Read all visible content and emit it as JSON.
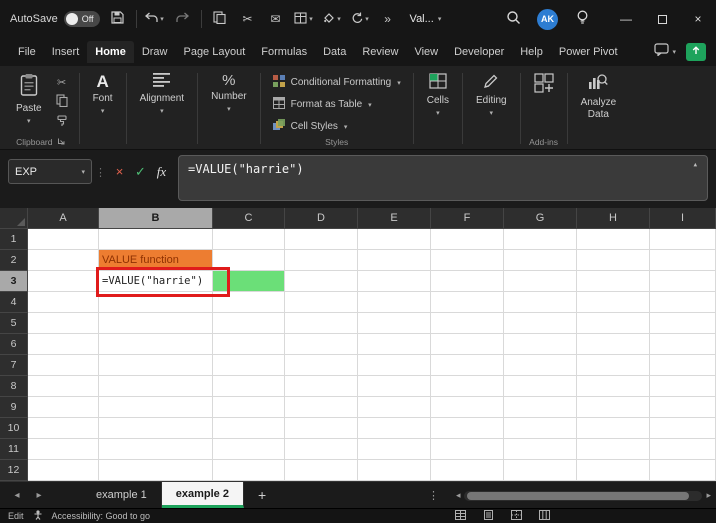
{
  "titlebar": {
    "autosave_label": "AutoSave",
    "autosave_state": "Off",
    "doc_name": "Val...",
    "avatar_initials": "AK",
    "overflow": "»"
  },
  "menubar": {
    "items": [
      "File",
      "Insert",
      "Home",
      "Draw",
      "Page Layout",
      "Formulas",
      "Data",
      "Review",
      "View",
      "Developer",
      "Help",
      "Power Pivot"
    ],
    "active": "Home"
  },
  "ribbon": {
    "paste_label": "Paste",
    "font_label": "Font",
    "alignment_label": "Alignment",
    "number_label": "Number",
    "styles_items": [
      "Conditional Formatting",
      "Format as Table",
      "Cell Styles"
    ],
    "cells_label": "Cells",
    "editing_label": "Editing",
    "analyze_line1": "Analyze",
    "analyze_line2": "Data",
    "clipboard_group_label": "Clipboard",
    "styles_group_label": "Styles",
    "addins_group_label": "Add-ins"
  },
  "formula_bar": {
    "name_box_value": "EXP",
    "fx_label": "fx",
    "formula": "=VALUE(\"harrie\")"
  },
  "grid": {
    "columns": [
      "A",
      "B",
      "C",
      "D",
      "E",
      "F",
      "G",
      "H",
      "I"
    ],
    "rows": [
      "1",
      "2",
      "3",
      "4",
      "5",
      "6",
      "7",
      "8",
      "9",
      "10",
      "11",
      "12"
    ],
    "selected_column": "B",
    "selected_row": "3",
    "cells": [
      {
        "ref": "B2",
        "text": "VALUE function",
        "bg": "#ED7D31",
        "color": "#8F3102",
        "mono": false
      },
      {
        "ref": "B3",
        "text": "=VALUE(\"harrie\")",
        "bg": "#FFFFFF",
        "color": "#1F1F1F",
        "mono": true
      },
      {
        "ref": "C3",
        "text": "",
        "bg": "#6BDF78",
        "color": "#000000",
        "mono": false
      }
    ],
    "annotation": {
      "target": "B3",
      "color": "#E01B1B"
    }
  },
  "sheet_tabs": {
    "tabs": [
      {
        "label": "example 1",
        "active": false
      },
      {
        "label": "example 2",
        "active": true
      }
    ],
    "add_label": "+"
  },
  "status_bar": {
    "mode": "Edit",
    "accessibility": "Accessibility: Good to go"
  },
  "colors": {
    "accent_green": "#1EA35C",
    "cell_orange": "#ED7D31",
    "highlight_green": "#6BDF78",
    "annotation_red": "#E01B1B",
    "header_selected": "#A9A9A9"
  }
}
